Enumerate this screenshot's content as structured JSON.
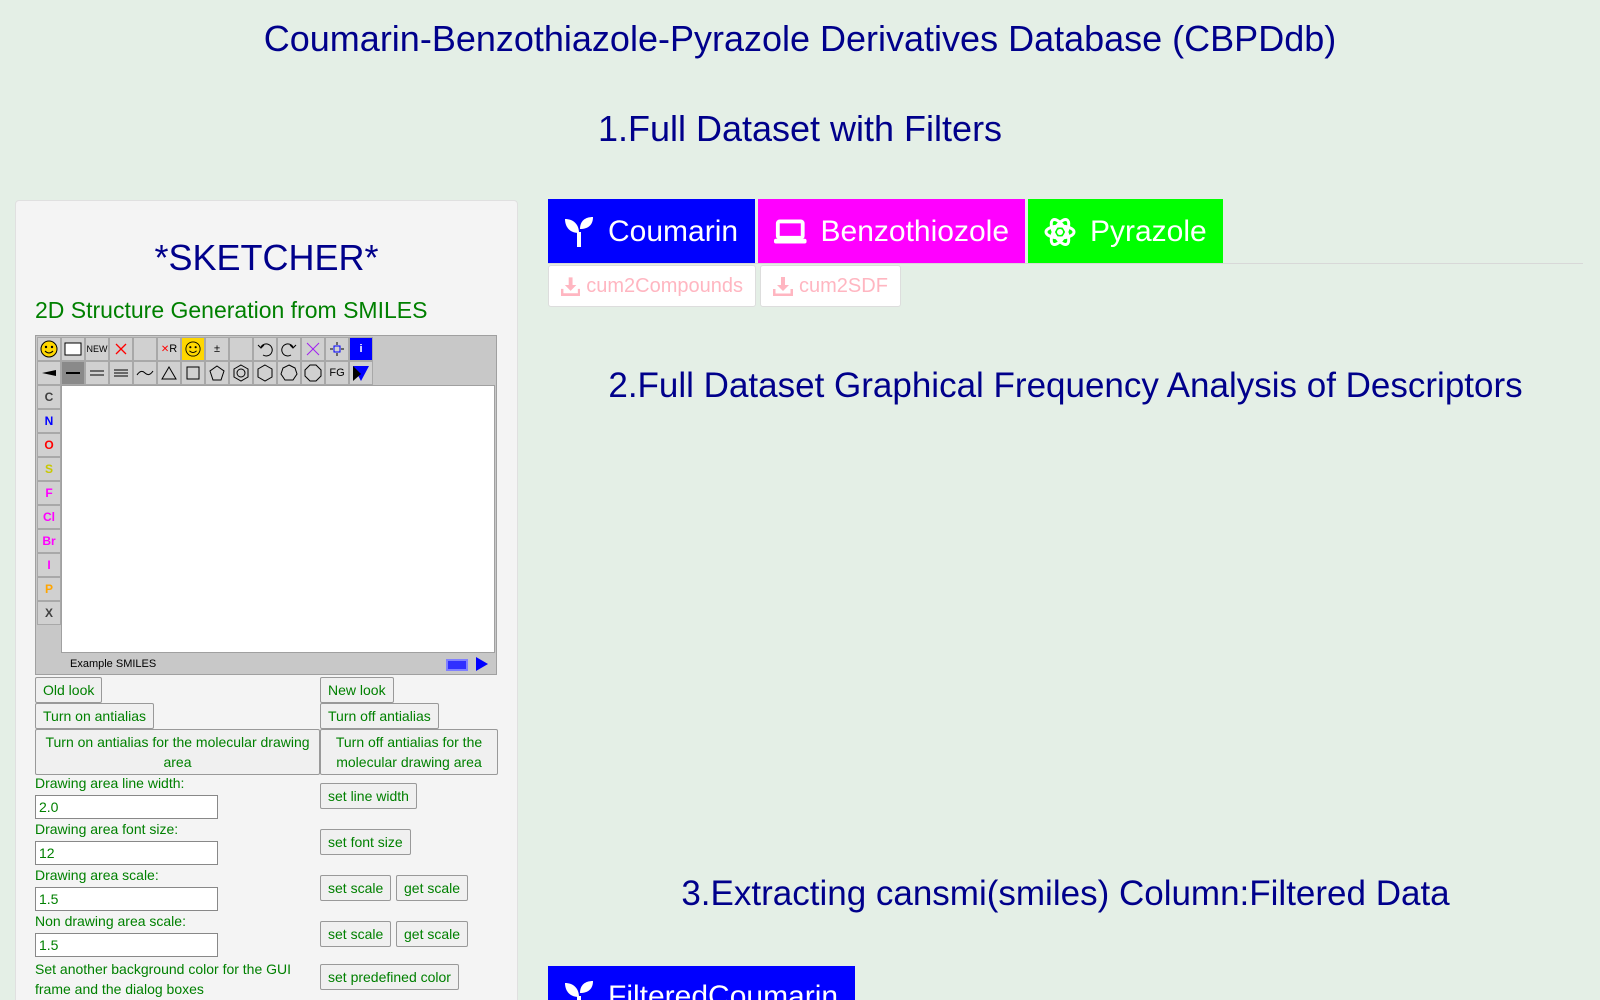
{
  "title": "Coumarin-Benzothiazole-Pyrazole Derivatives Database (CBPDdb)",
  "section1": "1.Full Dataset with Filters",
  "section2": "2.Full Dataset Graphical Frequency Analysis of Descriptors",
  "section3": "3.Extracting cansmi(smiles) Column:Filtered Data",
  "sketcher": {
    "title": "*SKETCHER*",
    "subtitle": "2D Structure Generation from SMILES",
    "toolbar": {
      "new": "NEW",
      "r": "R",
      "info": "i",
      "pm": "±",
      "fg": "FG"
    },
    "atoms": [
      "C",
      "N",
      "O",
      "S",
      "F",
      "Cl",
      "Br",
      "I",
      "P",
      "X"
    ],
    "atom_colors": [
      "#404040",
      "#0000ff",
      "#ff0000",
      "#c8c800",
      "#ff00ff",
      "#ff00ff",
      "#ff00ff",
      "#ff00ff",
      "#ffa500",
      "#404040"
    ],
    "status": "Example SMILES",
    "old_look": "Old look",
    "new_look": "New look",
    "antialias_on": "Turn on antialias",
    "antialias_off": "Turn off antialias",
    "antialias_mol_on": "Turn on antialias for the molecular drawing area",
    "antialias_mol_off": "Turn off antialias for the molecular drawing area",
    "line_width_label": "Drawing area line width:",
    "line_width_value": "2.0",
    "set_line_width": "set line width",
    "font_size_label": "Drawing area font size:",
    "font_size_value": "12",
    "set_font_size": "set font size",
    "scale_label": "Drawing area scale:",
    "scale_value": "1.5",
    "set_scale": "set scale",
    "get_scale": "get scale",
    "non_scale_label": "Non drawing area scale:",
    "non_scale_value": "1.5",
    "set_scale2": "set scale",
    "get_scale2": "get scale",
    "bg_label": "Set another background color for the GUI frame and the dialog boxes",
    "set_predefined": "set predefined color"
  },
  "tabs": [
    {
      "label": "Coumarin",
      "color": "#0000ff",
      "icon": "seedling-icon"
    },
    {
      "label": "Benzothiozole",
      "color": "#ff00ff",
      "icon": "laptop-icon"
    },
    {
      "label": "Pyrazole",
      "color": "#00ff00",
      "icon": "atom-icon"
    }
  ],
  "downloads": [
    "cum2Compounds",
    "cum2SDF"
  ],
  "bottom_tab": {
    "label": "FilteredCoumarin",
    "color": "#0000ff",
    "icon": "seedling-icon"
  }
}
